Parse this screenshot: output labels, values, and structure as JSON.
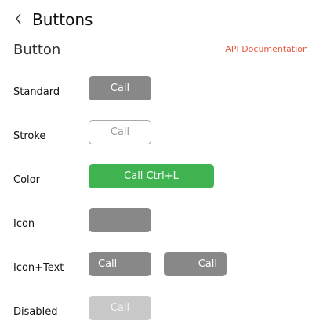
{
  "header": {
    "title": "Buttons",
    "back_icon": "chevron-left-icon"
  },
  "section": {
    "title": "Button",
    "api_link": "API Documentation"
  },
  "rows": [
    {
      "label": "Standard",
      "button": "Call"
    },
    {
      "label": "Stroke",
      "button": "Call"
    },
    {
      "label": "Color",
      "button": "Call Ctrl+L"
    },
    {
      "label": "Icon",
      "button": "",
      "icon": "call-icon"
    },
    {
      "label": "Icon+Text",
      "buttons": [
        "Call",
        "Call"
      ],
      "icon": "call-icon"
    },
    {
      "label": "Disabled",
      "button": "Call"
    }
  ],
  "colors": {
    "accent_link": "#e9573f",
    "color_button": "#3eb34f",
    "standard_button": "#888888",
    "disabled_button": "#c9c9c9"
  }
}
